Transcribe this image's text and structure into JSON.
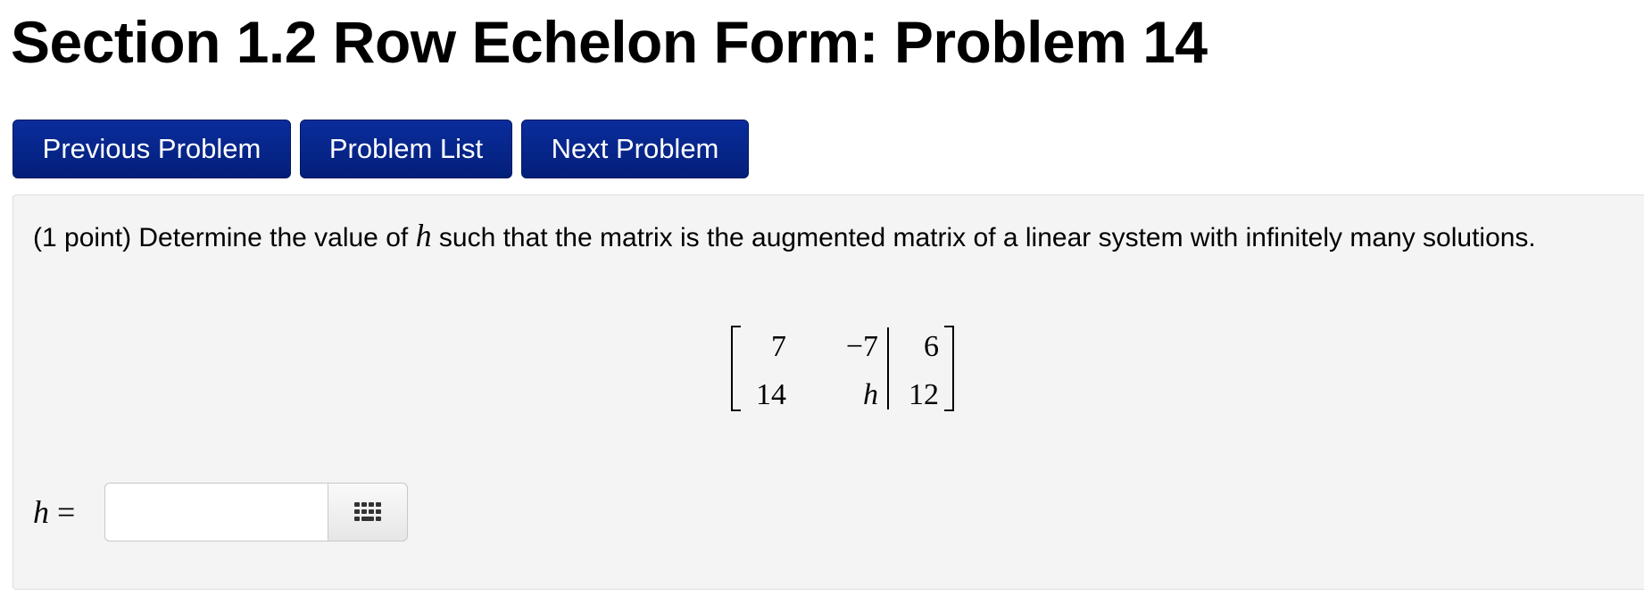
{
  "header": {
    "title": "Section 1.2 Row Echelon Form: Problem 14"
  },
  "nav": {
    "previous_label": "Previous Problem",
    "list_label": "Problem List",
    "next_label": "Next Problem"
  },
  "problem": {
    "text_before": "(1 point) Determine the value of ",
    "variable": "h",
    "text_after": " such that the matrix is the augmented matrix of a linear system with infinitely many solutions.",
    "matrix": {
      "rows": [
        [
          "7",
          "−7",
          "6"
        ],
        [
          "14",
          "h",
          "12"
        ]
      ]
    }
  },
  "answer": {
    "variable": "h",
    "equals": "=",
    "value": "",
    "editor_icon": "keypad-grid-icon"
  }
}
